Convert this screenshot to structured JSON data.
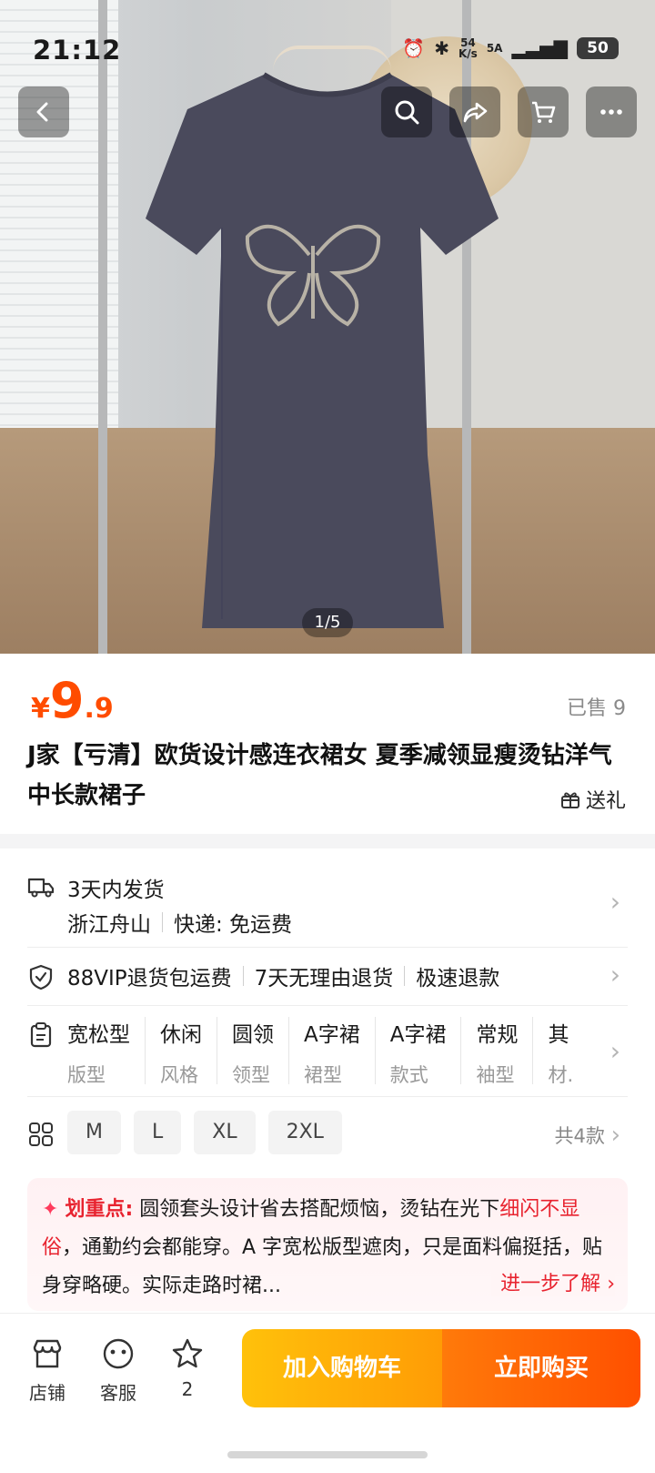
{
  "status_bar": {
    "time": "21:12",
    "net_speed_top": "54",
    "net_speed_bottom": "K/s",
    "signal": "5A",
    "battery": "50"
  },
  "gallery": {
    "counter": "1/5"
  },
  "top_actions": [
    "back-icon",
    "search-icon",
    "share-icon",
    "cart-icon",
    "more-icon"
  ],
  "product": {
    "price_symbol": "¥",
    "price_int": "9",
    "price_dec": ".9",
    "sold": "已售 9",
    "title": "J家【亏清】欧货设计感连衣裙女 夏季减领显瘦烫钻洋气中长款裙子",
    "gift": "送礼"
  },
  "shipping": {
    "eta": "3天内发货",
    "origin": "浙江舟山",
    "delivery": "快递: 免运费"
  },
  "services": [
    "88VIP退货包运费",
    "7天无理由退货",
    "极速退款"
  ],
  "attributes": [
    {
      "value": "宽松型",
      "key": "版型"
    },
    {
      "value": "休闲",
      "key": "风格"
    },
    {
      "value": "圆领",
      "key": "领型"
    },
    {
      "value": "A字裙",
      "key": "裙型"
    },
    {
      "value": "A字裙",
      "key": "款式"
    },
    {
      "value": "常规",
      "key": "袖型"
    },
    {
      "value": "其",
      "key": "材."
    }
  ],
  "sizes": [
    "M",
    "L",
    "XL",
    "2XL"
  ],
  "sizes_total": "共4款",
  "highlight": {
    "label": "划重点:",
    "text_a": "圆领套头设计省去搭配烦恼，烫钻在光下",
    "text_red": "细闪不显俗",
    "text_b": "，通勤约会都能穿。A 字宽松版型遮肉，只是面料偏挺括，贴身穿略硬。实际走路时裙...",
    "more": "进一步了解"
  },
  "bottom_bar": {
    "shop": "店铺",
    "service": "客服",
    "fav_count": "2",
    "add_cart": "加入购物车",
    "buy_now": "立即购买"
  },
  "colors": {
    "price": "#ff4c00",
    "highlight": "#e8232f",
    "cart_btn": "#ffb30a",
    "buy_btn": "#ff5a00"
  }
}
